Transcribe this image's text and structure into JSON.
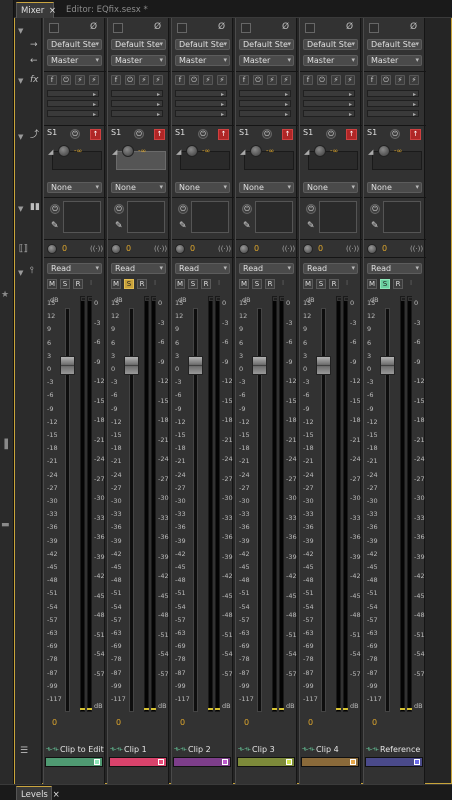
{
  "tabs": [
    {
      "label": "Mixer",
      "close": "×",
      "active": true
    },
    {
      "label": "Editor: EQfix.sesx *",
      "close": "",
      "active": false
    }
  ],
  "bottom_tab": {
    "label": "Levels",
    "close": "×"
  },
  "gutter_icons": {
    "io": "⇄",
    "fx": "fx",
    "sends": "⇢",
    "eq": "▮",
    "pan": "◖",
    "auto": "Ⅰ"
  },
  "zero_value": "0",
  "inf_value": "-∞",
  "input_label": "Default Ste",
  "output_label": "Master",
  "send_label": "S1",
  "send_bus": "None",
  "automation": "Read",
  "db_label": "dB",
  "msr": {
    "m": "M",
    "s": "S",
    "r": "R",
    "i": "I"
  },
  "fader_scale": [
    "15",
    "12",
    "9",
    "6",
    "3",
    "0",
    "-3",
    "-6",
    "-9",
    "-12",
    "-15",
    "-18",
    "-21",
    "-24",
    "-27",
    "-30",
    "-33",
    "-36",
    "-39",
    "-42",
    "-45",
    "-48",
    "-51",
    "-54",
    "-57",
    "-63",
    "-69",
    "-78",
    "-87",
    "-99",
    "-117"
  ],
  "meter_scale": [
    "0",
    "-3",
    "-6",
    "-9",
    "-12",
    "-15",
    "-18",
    "-21",
    "-24",
    "-27",
    "-30",
    "-33",
    "-36",
    "-39",
    "-42",
    "-45",
    "-48",
    "-51",
    "-54",
    "-57"
  ],
  "channels": [
    {
      "name": "Clip to Edit",
      "color": "#4f9a72",
      "swatch": "#8de6b8",
      "s_on": false,
      "m_on": false
    },
    {
      "name": "Clip 1",
      "color": "#d9436c",
      "swatch": "#e84b7a",
      "s_on": true,
      "m_on": false
    },
    {
      "name": "Clip 2",
      "color": "#7d3e8a",
      "swatch": "#c05ad0",
      "s_on": false,
      "m_on": false
    },
    {
      "name": "Clip 3",
      "color": "#7d8a3a",
      "swatch": "#cfe34a",
      "s_on": false,
      "m_on": false
    },
    {
      "name": "Clip 4",
      "color": "#8a6a3a",
      "swatch": "#e8a84a",
      "s_on": false,
      "m_on": false
    },
    {
      "name": "Reference",
      "color": "#4a4a8a",
      "swatch": "#6a6ae8",
      "s_on": false,
      "m_on": true
    }
  ]
}
